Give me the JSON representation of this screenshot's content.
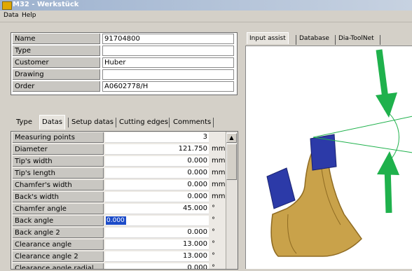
{
  "window": {
    "title": "M32 - Werkstück"
  },
  "menu": {
    "items": [
      "Data",
      "Help"
    ]
  },
  "info": {
    "rows": [
      {
        "label": "Name",
        "value": "91704800"
      },
      {
        "label": "Type",
        "value": ""
      },
      {
        "label": "Customer",
        "value": "Huber"
      },
      {
        "label": "Drawing",
        "value": ""
      },
      {
        "label": "Order",
        "value": "A0602778/H"
      }
    ]
  },
  "left_tabs": {
    "items": [
      "Type",
      "Datas",
      "Setup datas",
      "Cutting edges",
      "Comments"
    ],
    "active": "Datas"
  },
  "grid": {
    "rows": [
      {
        "label": "Measuring points",
        "value": "3",
        "unit": ""
      },
      {
        "label": "Diameter",
        "value": "121.750",
        "unit": "mm"
      },
      {
        "label": "Tip's width",
        "value": "0.000",
        "unit": "mm"
      },
      {
        "label": "Tip's length",
        "value": "0.000",
        "unit": "mm"
      },
      {
        "label": "Chamfer's width",
        "value": "0.000",
        "unit": "mm"
      },
      {
        "label": "Back's width",
        "value": "0.000",
        "unit": "mm"
      },
      {
        "label": "Chamfer angle",
        "value": "45.000",
        "unit": "°"
      },
      {
        "label": "Back angle",
        "value": "0.000",
        "unit": "°"
      },
      {
        "label": "Back angle 2",
        "value": "0.000",
        "unit": "°"
      },
      {
        "label": "Clearance angle",
        "value": "13.000",
        "unit": "°"
      },
      {
        "label": "Clearance angle 2",
        "value": "13.000",
        "unit": "°"
      },
      {
        "label": "Clearance angle radial",
        "value": "0.000",
        "unit": "°"
      }
    ],
    "selected_row": "Back angle"
  },
  "right_tabs": {
    "items": [
      "Input assist",
      "Database",
      "Dia-ToolNet"
    ],
    "active": "Input assist"
  },
  "colors": {
    "arrow_green": "#1fb14c",
    "tip_blue": "#2c3aa8",
    "body_gold": "#c9a24a",
    "selection": "#1c4bc8"
  }
}
